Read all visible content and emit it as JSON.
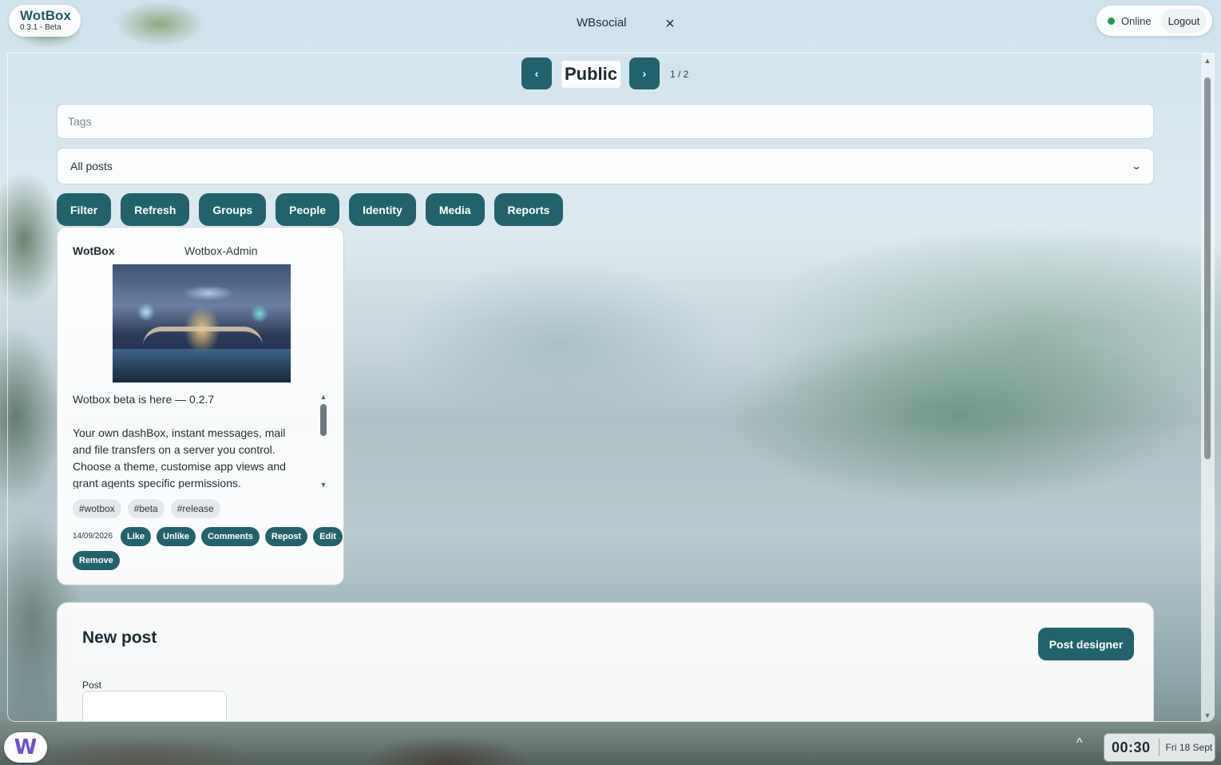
{
  "brand": {
    "name": "WotBox",
    "version": "0.3.1 - Beta"
  },
  "window": {
    "title": "WBsocial",
    "close_glyph": "×"
  },
  "status": {
    "label": "Online",
    "logout_label": "Logout",
    "dot_color": "#1f9a55"
  },
  "pager": {
    "prev_glyph": "‹",
    "next_glyph": "›",
    "title": "Public",
    "count": "1 / 2"
  },
  "filters": {
    "tags_placeholder": "Tags",
    "select_value": "All posts"
  },
  "actions": [
    "Filter",
    "Refresh",
    "Groups",
    "People",
    "Identity",
    "Media",
    "Reports"
  ],
  "post": {
    "author": "WotBox",
    "handle": "Wotbox-Admin",
    "text_line1": "Wotbox beta is here — 0.2.7",
    "text_body": "Your own dashBox, instant messages, mail and file transfers on a server you control. Choose a theme, customise app views and grant agents specific permissions.",
    "tags": [
      "#wotbox",
      "#beta",
      "#release"
    ],
    "date": "14/09/2026",
    "buttons": [
      "Like",
      "Unlike",
      "Comments",
      "Repost",
      "Edit"
    ],
    "remove_label": "Remove"
  },
  "new_post": {
    "title": "New post",
    "designer_label": "Post designer",
    "field_label": "Post"
  },
  "taskbar": {
    "logo_letter": "W",
    "tray_caret": "^",
    "time": "00:30",
    "date": "Fri 18 Sept"
  },
  "colors": {
    "accent": "#22626c",
    "brand_text": "#1e5a63"
  }
}
